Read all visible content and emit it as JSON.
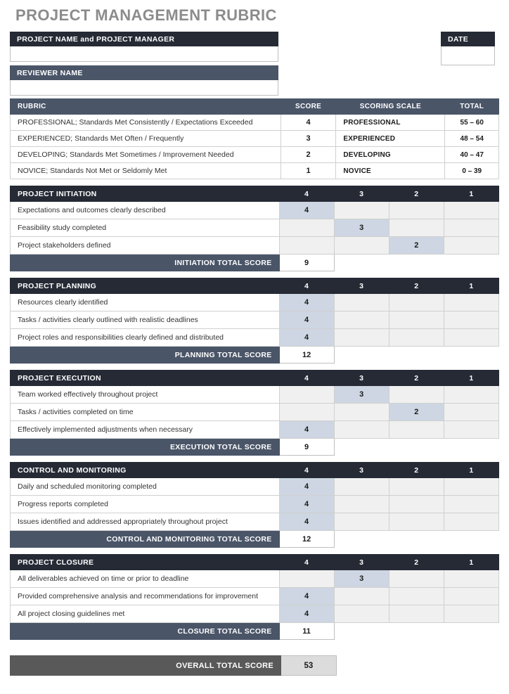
{
  "document": {
    "title": "PROJECT MANAGEMENT RUBRIC"
  },
  "identity": {
    "project_name_label": "PROJECT NAME and PROJECT MANAGER",
    "project_name_value": "",
    "reviewer_label": "REVIEWER NAME",
    "reviewer_value": "",
    "date_label": "DATE",
    "date_value": ""
  },
  "legend": {
    "headers": {
      "rubric": "RUBRIC",
      "score": "SCORE",
      "scoring_scale": "SCORING SCALE",
      "total": "TOTAL"
    },
    "rows": [
      {
        "description": "PROFESSIONAL; Standards Met Consistently / Expectations Exceeded",
        "score": "4",
        "scale": "PROFESSIONAL",
        "total": "55 – 60"
      },
      {
        "description": "EXPERIENCED; Standards Met Often / Frequently",
        "score": "3",
        "scale": "EXPERIENCED",
        "total": "48 – 54"
      },
      {
        "description": "DEVELOPING; Standards Met Sometimes / Improvement Needed",
        "score": "2",
        "scale": "DEVELOPING",
        "total": "40 – 47"
      },
      {
        "description": "NOVICE; Standards Not Met or Seldomly Met",
        "score": "1",
        "scale": "NOVICE",
        "total": "0 – 39"
      }
    ]
  },
  "rating_columns": [
    "4",
    "3",
    "2",
    "1"
  ],
  "sections": [
    {
      "name": "PROJECT INITIATION",
      "criteria": [
        {
          "label": "Expectations and outcomes clearly described",
          "scores": [
            "4",
            "",
            "",
            ""
          ]
        },
        {
          "label": "Feasibility study completed",
          "scores": [
            "",
            "3",
            "",
            ""
          ]
        },
        {
          "label": "Project stakeholders defined",
          "scores": [
            "",
            "",
            "2",
            ""
          ]
        }
      ],
      "total_label": "INITIATION TOTAL SCORE",
      "total_value": "9"
    },
    {
      "name": "PROJECT PLANNING",
      "criteria": [
        {
          "label": "Resources clearly identified",
          "scores": [
            "4",
            "",
            "",
            ""
          ]
        },
        {
          "label": "Tasks / activities clearly outlined with realistic deadlines",
          "scores": [
            "4",
            "",
            "",
            ""
          ]
        },
        {
          "label": "Project roles and responsibilities clearly defined and distributed",
          "scores": [
            "4",
            "",
            "",
            ""
          ]
        }
      ],
      "total_label": "PLANNING TOTAL SCORE",
      "total_value": "12"
    },
    {
      "name": "PROJECT EXECUTION",
      "criteria": [
        {
          "label": "Team worked effectively throughout project",
          "scores": [
            "",
            "3",
            "",
            ""
          ]
        },
        {
          "label": "Tasks / activities completed on time",
          "scores": [
            "",
            "",
            "2",
            ""
          ]
        },
        {
          "label": "Effectively implemented adjustments when necessary",
          "scores": [
            "4",
            "",
            "",
            ""
          ]
        }
      ],
      "total_label": "EXECUTION TOTAL SCORE",
      "total_value": "9"
    },
    {
      "name": "CONTROL AND MONITORING",
      "criteria": [
        {
          "label": "Daily and scheduled monitoring completed",
          "scores": [
            "4",
            "",
            "",
            ""
          ]
        },
        {
          "label": "Progress reports completed",
          "scores": [
            "4",
            "",
            "",
            ""
          ]
        },
        {
          "label": "Issues identified and addressed appropriately throughout project",
          "scores": [
            "4",
            "",
            "",
            ""
          ]
        }
      ],
      "total_label": "CONTROL AND MONITORING TOTAL SCORE",
      "total_value": "12"
    },
    {
      "name": "PROJECT CLOSURE",
      "criteria": [
        {
          "label": "All deliverables achieved on time or prior to deadline",
          "scores": [
            "",
            "3",
            "",
            ""
          ]
        },
        {
          "label": "Provided comprehensive analysis and recommendations for improvement",
          "scores": [
            "4",
            "",
            "",
            ""
          ]
        },
        {
          "label": "All project closing guidelines met",
          "scores": [
            "4",
            "",
            "",
            ""
          ]
        }
      ],
      "total_label": "CLOSURE TOTAL SCORE",
      "total_value": "11"
    }
  ],
  "overall": {
    "label": "OVERALL TOTAL SCORE",
    "value": "53"
  },
  "colors": {
    "header_dark": "#252a35",
    "header_slate": "#4a5568",
    "cell_selected": "#cdd6e2",
    "cell_empty": "#f0f0f0",
    "overall_bar": "#595959",
    "title_gray": "#8c8c8c"
  }
}
